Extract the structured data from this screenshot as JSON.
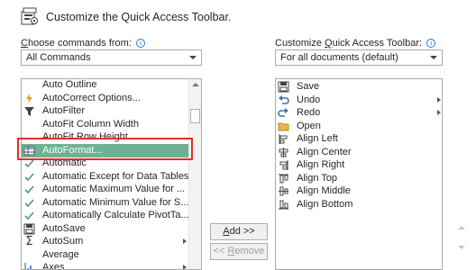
{
  "header": {
    "title": "Customize the Quick Access Toolbar."
  },
  "left": {
    "label_prefix": "C",
    "label_rest": "hoose commands from:",
    "combo_value": "All Commands",
    "items": [
      {
        "label": "Auto Outline",
        "icon": "blank-icon"
      },
      {
        "label": "AutoCorrect Options...",
        "icon": "lightning-icon"
      },
      {
        "label": "AutoFilter",
        "icon": "filter-icon"
      },
      {
        "label": "AutoFit Column Width",
        "icon": "blank-icon"
      },
      {
        "label": "AutoFit Row Height",
        "icon": "blank-icon"
      },
      {
        "label": "AutoFormat...",
        "icon": "table-format-icon",
        "selected": true
      },
      {
        "label": "Automatic",
        "icon": "check-icon"
      },
      {
        "label": "Automatic Except for Data Tables",
        "icon": "check-icon"
      },
      {
        "label": "Automatic Maximum Value for ...",
        "icon": "check-icon"
      },
      {
        "label": "Automatic Minimum Value for S...",
        "icon": "check-icon"
      },
      {
        "label": "Automatically Calculate PivotTa...",
        "icon": "check-icon"
      },
      {
        "label": "AutoSave",
        "icon": "floppy-icon"
      },
      {
        "label": "AutoSum",
        "icon": "sigma-icon",
        "submenu": true
      },
      {
        "label": "Average",
        "icon": "blank-icon"
      },
      {
        "label": "Axes",
        "icon": "axes-icon",
        "submenu": true
      }
    ]
  },
  "right": {
    "label_prefix": "Customize ",
    "label_u": "Q",
    "label_rest": "uick Access Toolbar:",
    "combo_value": "For all documents (default)",
    "items": [
      {
        "label": "Save",
        "icon": "save-icon"
      },
      {
        "label": "Undo",
        "icon": "undo-icon",
        "submenu": true
      },
      {
        "label": "Redo",
        "icon": "redo-icon",
        "submenu": true
      },
      {
        "label": "Open",
        "icon": "folder-icon"
      },
      {
        "label": "Align Left",
        "icon": "align-left-icon"
      },
      {
        "label": "Align Center",
        "icon": "align-center-icon"
      },
      {
        "label": "Align Right",
        "icon": "align-right-icon"
      },
      {
        "label": "Align Top",
        "icon": "align-top-icon"
      },
      {
        "label": "Align Middle",
        "icon": "align-middle-icon"
      },
      {
        "label": "Align Bottom",
        "icon": "align-bottom-icon"
      }
    ]
  },
  "buttons": {
    "add_u": "A",
    "add_rest": "dd >>",
    "remove_prefix": "<< ",
    "remove_u": "R",
    "remove_rest": "emove"
  },
  "colors": {
    "selection": "#6fb291",
    "highlight_border": "#e0302c",
    "info": "#2b79d0"
  }
}
